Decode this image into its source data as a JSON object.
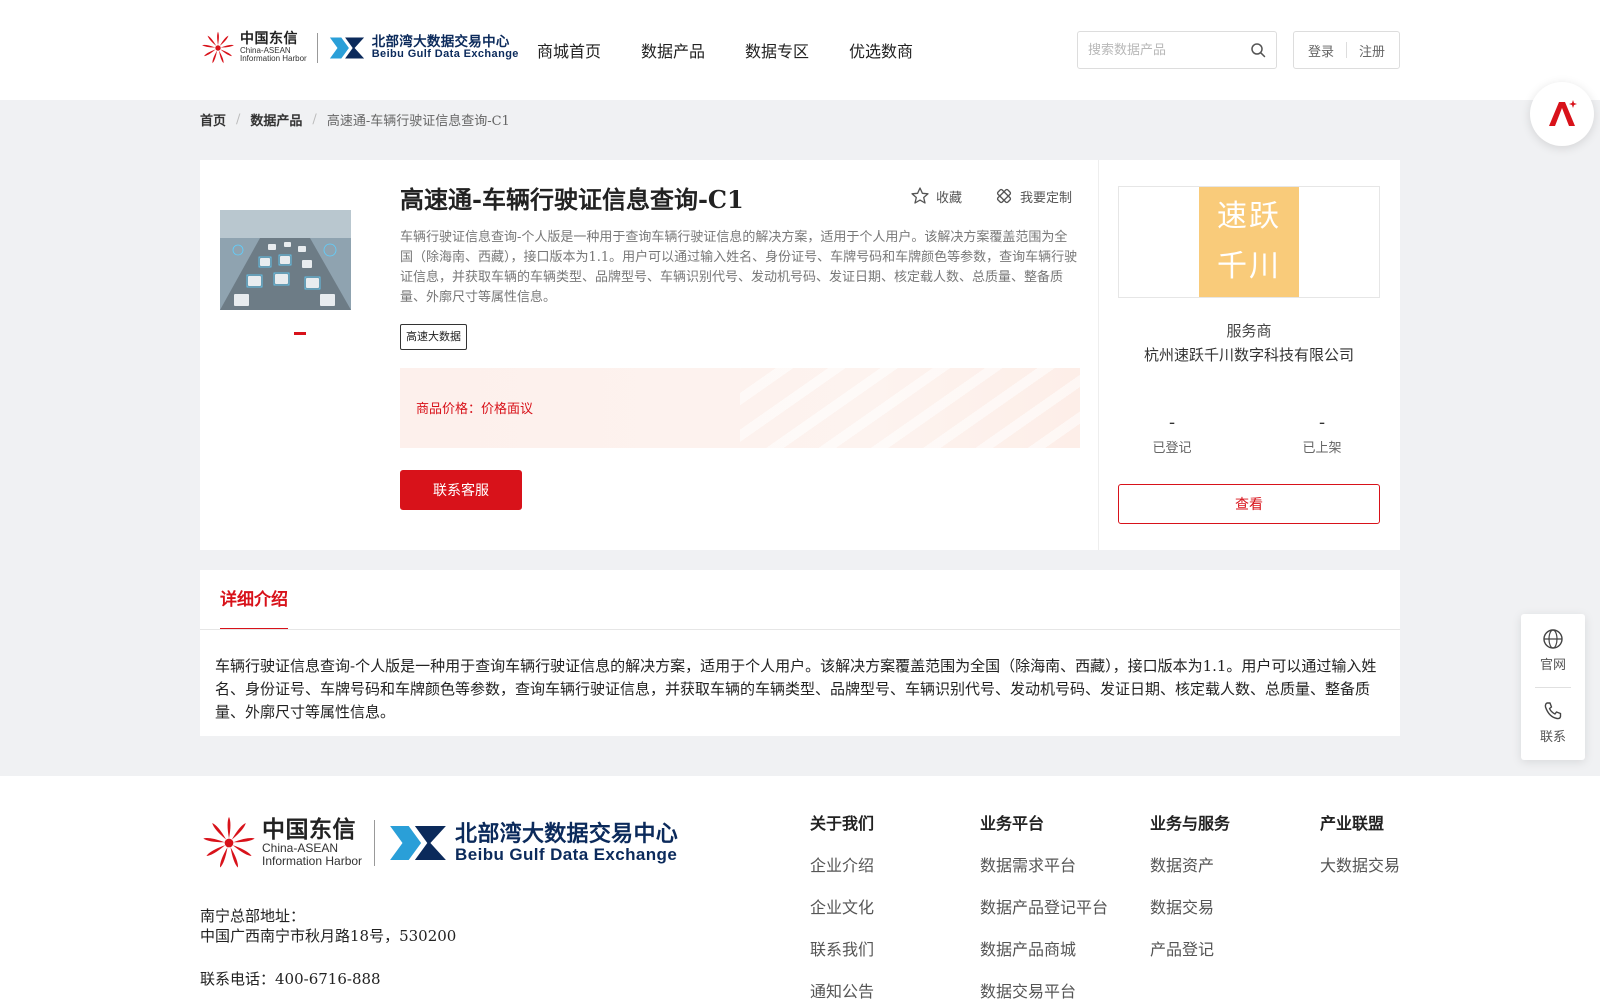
{
  "brand": {
    "ct_cn": "中国东信",
    "ct_en1": "China-ASEAN",
    "ct_en2": "Information Harbor",
    "bb_cn": "北部湾大数据交易中心",
    "bb_en": "Beibu Gulf Data Exchange"
  },
  "nav": {
    "items": [
      {
        "label": "商城首页"
      },
      {
        "label": "数据产品"
      },
      {
        "label": "数据专区"
      },
      {
        "label": "优选数商"
      }
    ]
  },
  "search": {
    "placeholder": "搜索数据产品",
    "value": ""
  },
  "auth": {
    "login": "登录",
    "register": "注册"
  },
  "breadcrumb": {
    "home": "首页",
    "products": "数据产品",
    "current": "高速通-车辆行驶证信息查询-C1"
  },
  "product": {
    "title": "高速通-车辆行驶证信息查询-C1",
    "favorite_label": "收藏",
    "customize_label": "我要定制",
    "description": "车辆行驶证信息查询-个人版是一种用于查询车辆行驶证信息的解决方案，适用于个人用户。该解决方案覆盖范围为全国（除海南、西藏），接口版本为1.1。用户可以通过输入姓名、身份证号、车牌号码和车牌颜色等参数，查询车辆行驶证信息，并获取车辆的车辆类型、品牌型号、车辆识别代号、发动机号码、发证日期、核定载人数、总质量、整备质量、外廓尺寸等属性信息。",
    "tag": "高速大数据",
    "price_label": "商品价格：",
    "price_value": "价格面议",
    "contact_label": "联系客服"
  },
  "provider": {
    "logo_line1": "速跃",
    "logo_line2": "千川",
    "label": "服务商",
    "name": "杭州速跃千川数字科技有限公司",
    "stats": [
      {
        "value": "-",
        "label": "已登记"
      },
      {
        "value": "-",
        "label": "已上架"
      }
    ],
    "view_label": "查看"
  },
  "detail": {
    "tab_label": "详细介绍",
    "text": "车辆行驶证信息查询-个人版是一种用于查询车辆行驶证信息的解决方案，适用于个人用户。该解决方案覆盖范围为全国（除海南、西藏），接口版本为1.1。用户可以通过输入姓名、身份证号、车牌号码和车牌颜色等参数，查询车辆行驶证信息，并获取车辆的车辆类型、品牌型号、车辆识别代号、发动机号码、发证日期、核定载人数、总质量、整备质量、外廓尺寸等属性信息。"
  },
  "side": {
    "website": "官网",
    "contact": "联系"
  },
  "footer": {
    "address_label": "南宁总部地址：",
    "address": "中国广西南宁市秋月路18号，530200",
    "phone": "联系电话：400-6716-888",
    "columns": [
      {
        "title": "关于我们",
        "items": [
          "企业介绍",
          "企业文化",
          "联系我们",
          "通知公告"
        ]
      },
      {
        "title": "业务平台",
        "items": [
          "数据需求平台",
          "数据产品登记平台",
          "数据产品商城",
          "数据交易平台"
        ]
      },
      {
        "title": "业务与服务",
        "items": [
          "数据资产",
          "数据交易",
          "产品登记"
        ]
      },
      {
        "title": "产业联盟",
        "items": [
          "大数据交易"
        ]
      }
    ]
  },
  "colors": {
    "accent": "#d8121a",
    "brand_blue": "#0b2a5b",
    "provider_logo": "#f9cb7a"
  },
  "icons": [
    "china-telecom-logo-icon",
    "beibu-gulf-logo-icon",
    "search-icon",
    "star-icon",
    "customize-icon",
    "globe-icon",
    "phone-icon",
    "ai-assistant-icon"
  ]
}
